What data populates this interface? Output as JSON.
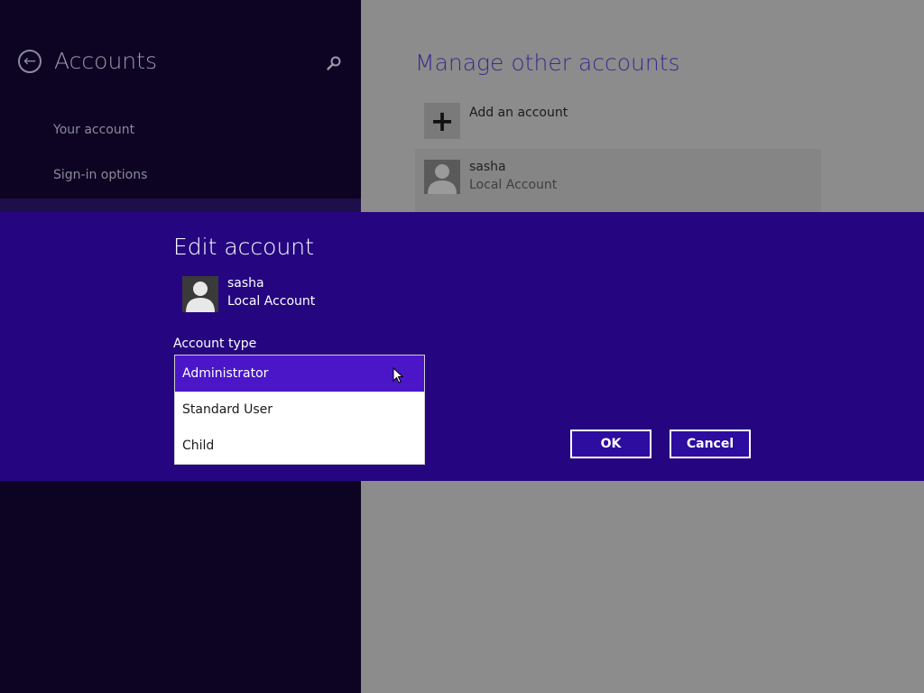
{
  "left_pane": {
    "title": "Accounts",
    "back_icon": "back-arrow-icon",
    "search_icon": "search-icon",
    "nav_items": [
      {
        "label": "Your account"
      },
      {
        "label": "Sign-in options"
      }
    ]
  },
  "right_pane": {
    "title": "Manage other accounts",
    "add_account_label": "Add an account",
    "add_icon": "plus-icon",
    "accounts": [
      {
        "name": "sasha",
        "type": "Local Account"
      }
    ]
  },
  "dialog": {
    "title": "Edit account",
    "user_name": "sasha",
    "user_type": "Local Account",
    "field_label": "Account type",
    "options": [
      {
        "label": "Administrator",
        "selected": true
      },
      {
        "label": "Standard User",
        "selected": false
      },
      {
        "label": "Child",
        "selected": false
      }
    ],
    "ok_label": "OK",
    "cancel_label": "Cancel"
  },
  "colors": {
    "accent": "#250680",
    "highlight": "#4a16c8",
    "nav_background": "#0d0424",
    "right_title": "#3a2b8c"
  }
}
